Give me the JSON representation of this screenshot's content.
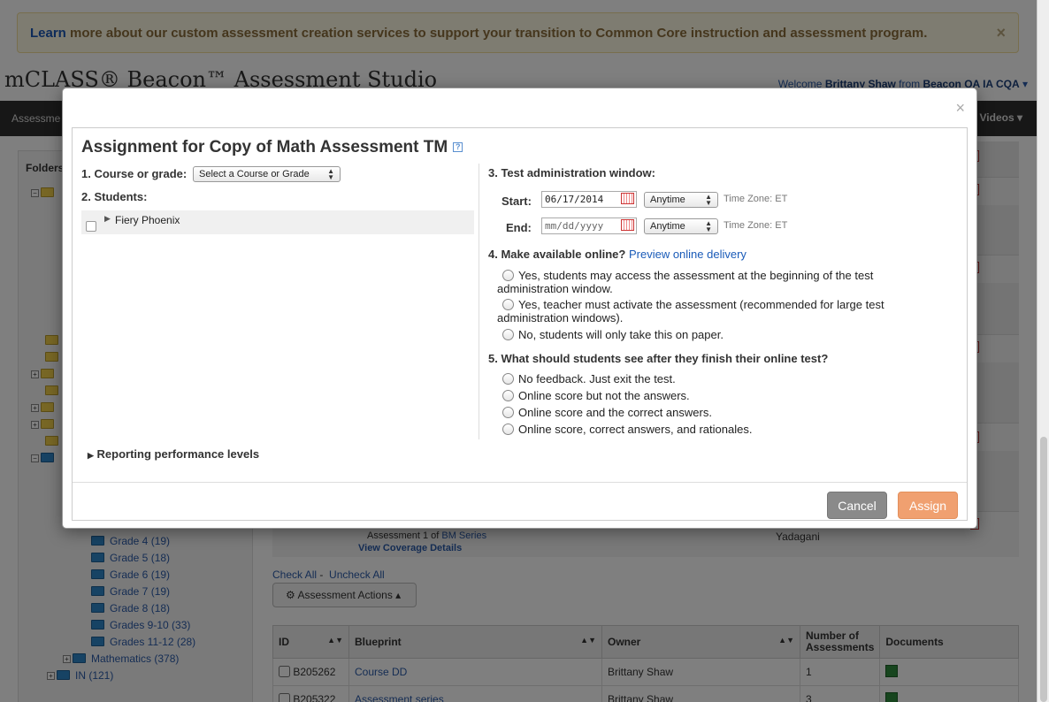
{
  "banner": {
    "link": "Learn",
    "text": " more about our custom assessment creation services to support your transition to Common Core instruction and assessment program.",
    "close": "×"
  },
  "header": {
    "app_title": "mCLASS® Beacon™ Assessment Studio",
    "welcome_prefix": "Welcome ",
    "user": "Brittany Shaw",
    "from": " from ",
    "org": "Beacon QA IA CQA"
  },
  "nav": {
    "left": "Assessme",
    "right": "Videos"
  },
  "sidebar": {
    "header": "Folders",
    "items": [
      {
        "label": "Grade 4 (19)"
      },
      {
        "label": "Grade 5 (18)"
      },
      {
        "label": "Grade 6 (19)"
      },
      {
        "label": "Grade 7 (19)"
      },
      {
        "label": "Grade 8 (18)"
      },
      {
        "label": "Grades 9-10 (33)"
      },
      {
        "label": "Grades 11-12 (28)"
      },
      {
        "label": "Mathematics (378)"
      },
      {
        "label": "IN (121)"
      }
    ]
  },
  "background": {
    "assessment_prefix": "Assessment 1 of ",
    "series": "BM Series",
    "coverage": "View Coverage Details",
    "owner_fragment": "Yadagani",
    "check_all": "Check All",
    "uncheck_all": "Uncheck All",
    "actions": "Assessment Actions"
  },
  "table": {
    "headers": [
      "ID",
      "Blueprint",
      "Owner",
      "Number of Assessments",
      "Documents"
    ],
    "rows": [
      {
        "id": "B205262",
        "blueprint": "Course DD",
        "owner": "Brittany Shaw",
        "count": "1"
      },
      {
        "id": "B205322",
        "blueprint": "Assessment series",
        "owner": "Brittany Shaw",
        "count": "3"
      }
    ]
  },
  "modal": {
    "close": "×",
    "title": "Assignment for Copy of Math Assessment TM",
    "help": "?",
    "course_label": "1. Course or grade:",
    "course_select": "Select a Course or Grade",
    "students_label": "2. Students:",
    "student_group": "Fiery Phoenix",
    "window_label": "3. Test administration window:",
    "start_label": "Start:",
    "start_value": "06/17/2014",
    "end_label": "End:",
    "end_placeholder": "mm/dd/yyyy",
    "time_select": "Anytime",
    "time_zone": "Time Zone: ET",
    "online_label": "4. Make available online?",
    "preview_link": "Preview online delivery",
    "online_options": [
      "Yes, students may access the assessment at the beginning of the test administration window.",
      "Yes, teacher must activate the assessment (recommended for large test administration windows).",
      "No, students will only take this on paper."
    ],
    "feedback_label": "5. What should students see after they finish their online test?",
    "feedback_options": [
      "No feedback. Just exit the test.",
      "Online score but not the answers.",
      "Online score and the correct answers.",
      "Online score, correct answers, and rationales."
    ],
    "reporting": "Reporting performance levels",
    "cancel": "Cancel",
    "assign": "Assign"
  }
}
